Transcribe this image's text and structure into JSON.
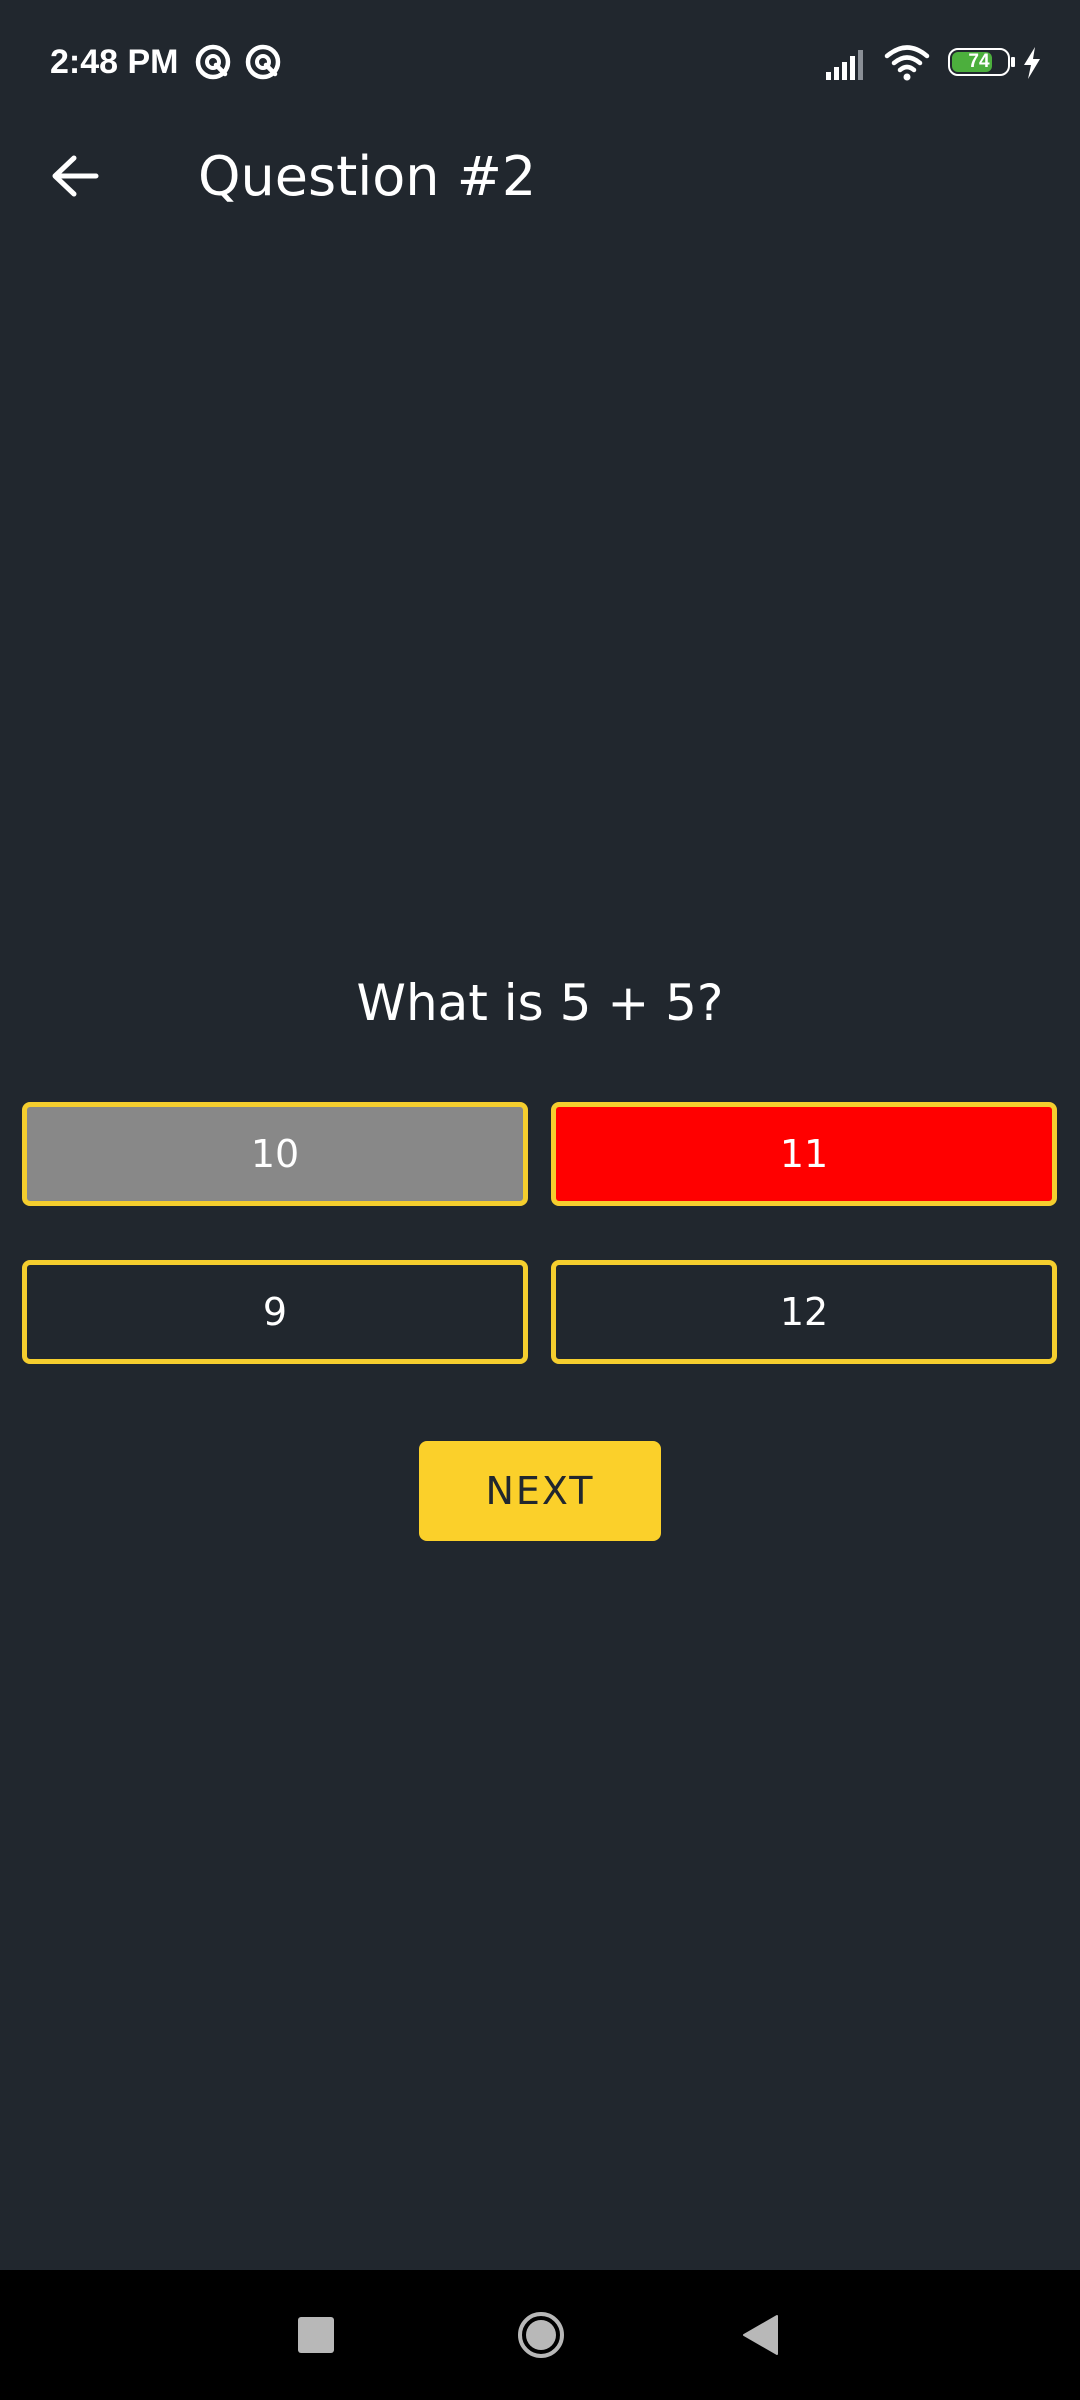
{
  "status_bar": {
    "time": "2:48 PM",
    "app_icons": [
      "notification-app-icon",
      "notification-app-icon"
    ],
    "battery_level": "74",
    "battery_fraction": 0.74,
    "charging": true,
    "icons": [
      "signal-icon",
      "wifi-icon",
      "battery-icon",
      "charging-bolt-icon"
    ]
  },
  "app_bar": {
    "back_icon": "arrow-left-icon",
    "title": "Question #2"
  },
  "question": {
    "text": "What is 5 + 5?"
  },
  "answers": [
    {
      "label": "10",
      "state": "correct-reveal",
      "background": "#888888"
    },
    {
      "label": "11",
      "state": "selected-wrong",
      "background": "#ff0000"
    },
    {
      "label": "9",
      "state": "default",
      "background": "#21272e"
    },
    {
      "label": "12",
      "state": "default",
      "background": "#21272e"
    }
  ],
  "next_button": {
    "label": "NEXT"
  },
  "nav_bar": {
    "icons": [
      "recents-square-icon",
      "home-circle-icon",
      "back-triangle-icon"
    ]
  },
  "colors": {
    "background": "#21272e",
    "accent": "#fbd02a",
    "answer_border": "#f5ce2e",
    "wrong": "#ff0000",
    "neutral": "#888888"
  }
}
